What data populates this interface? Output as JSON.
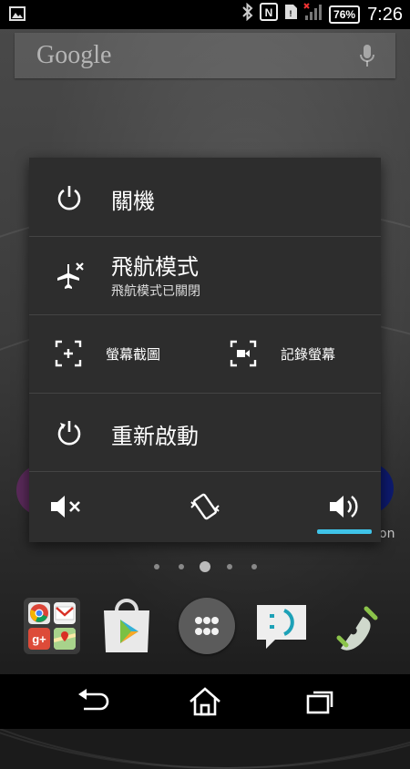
{
  "status_bar": {
    "notification_icon": "image-icon",
    "icons": [
      "bluetooth-icon",
      "nfc-icon",
      "sim-missing-icon",
      "signal-icon"
    ],
    "battery": "76%",
    "time": "7:26"
  },
  "search_widget": {
    "logo": "Google",
    "mic_icon": "mic-icon"
  },
  "power_menu": {
    "power_off": {
      "label": "關機",
      "icon": "power-icon"
    },
    "airplane": {
      "label": "飛航模式",
      "sublabel": "飛航模式已關閉",
      "icon": "airplane-icon"
    },
    "screenshot": {
      "label": "螢幕截圖",
      "icon": "screenshot-icon"
    },
    "record": {
      "label": "記錄螢幕",
      "icon": "screen-record-icon"
    },
    "restart": {
      "label": "重新啟動",
      "icon": "restart-icon"
    },
    "sound_modes": {
      "silent_icon": "volume-mute-icon",
      "vibrate_icon": "vibrate-icon",
      "sound_icon": "volume-on-icon",
      "selected": "sound",
      "accent": "#3fc3e8"
    }
  },
  "home": {
    "behind_text": "on",
    "page_count": 5,
    "active_page": 3,
    "dock": [
      "google-apps-folder",
      "play-store-icon",
      "app-drawer-icon",
      "messaging-icon",
      "phone-icon"
    ]
  },
  "nav_bar": [
    "back-icon",
    "home-icon",
    "recents-icon"
  ]
}
